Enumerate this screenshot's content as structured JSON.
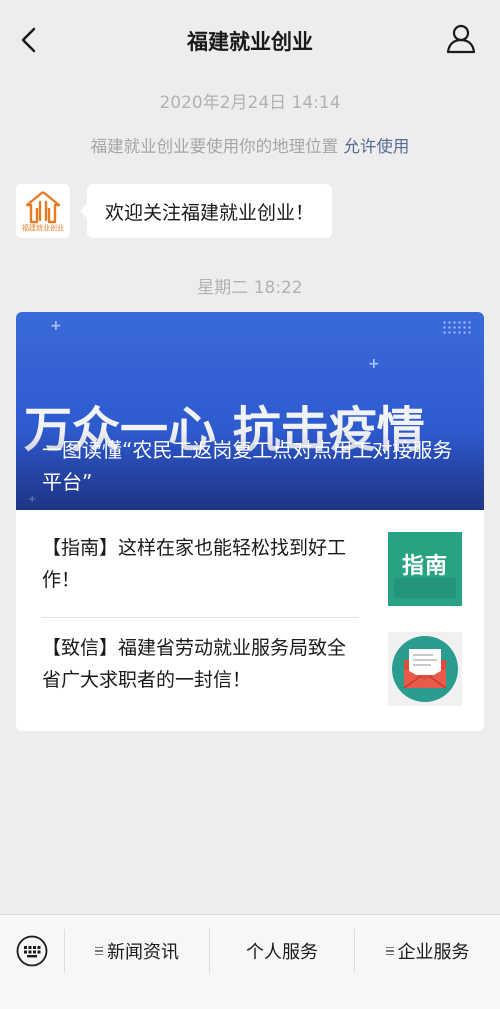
{
  "header": {
    "title": "福建就业创业",
    "back_icon": "chevron-left-icon",
    "profile_icon": "person-icon"
  },
  "chat": {
    "timestamp_1": "2020年2月24日 14:14",
    "location_notice": "福建就业创业要使用你的地理位置",
    "location_allow": "允许使用",
    "avatar_text": "福建就业创业",
    "welcome_message": "欢迎关注福建就业创业！",
    "timestamp_2": "星期二 18:22"
  },
  "article_card": {
    "banner_headline": "万众一心  抗击疫情",
    "banner_caption": "一图读懂“农民工返岗复工点对点用工对接服务平台”",
    "items": [
      {
        "text": "【指南】这样在家也能轻松找到好工作！",
        "thumb_label": "指南",
        "thumb_icon": "guide-icon"
      },
      {
        "text": "【致信】福建省劳动就业服务局致全省广大求职者的一封信！",
        "thumb_icon": "envelope-icon"
      }
    ]
  },
  "bottom_menu": {
    "keyboard_icon": "keyboard-icon",
    "items": [
      {
        "label": "新闻资讯",
        "has_submenu": true
      },
      {
        "label": "个人服务",
        "has_submenu": false
      },
      {
        "label": "企业服务",
        "has_submenu": true
      }
    ]
  },
  "colors": {
    "background": "#ededed",
    "link": "#576b95",
    "brand_orange": "#e87a22",
    "banner_blue": "#3a6ad8",
    "guide_green": "#27a383",
    "envelope_red": "#e04b3c"
  }
}
